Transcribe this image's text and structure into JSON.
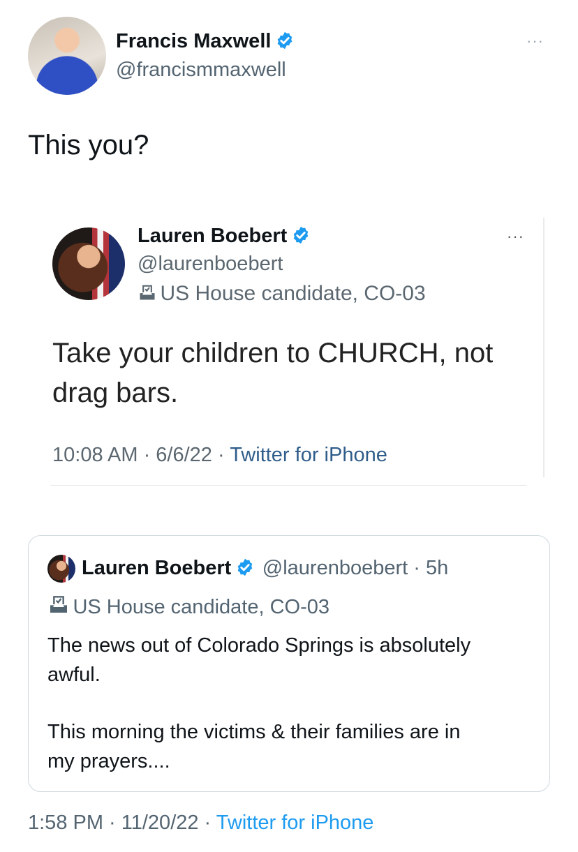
{
  "author": {
    "name": "Francis Maxwell",
    "handle": "@francismmaxwell",
    "more": "···"
  },
  "tweet": {
    "text": "This you?"
  },
  "screenshot": {
    "name": "Lauren Boebert",
    "handle": "@laurenboebert",
    "label": "US House candidate, CO-03",
    "more": "···",
    "text_line1": "Take your children to CHURCH, not",
    "text_line2": "drag bars.",
    "time": "10:08 AM · 6/6/22 · ",
    "source": "Twitter for iPhone"
  },
  "quote": {
    "name": "Lauren Boebert",
    "handle_time": "@laurenboebert · 5h",
    "label": "US House candidate, CO-03",
    "para1_line1": "The news out of Colorado Springs is absolutely",
    "para1_line2": "awful.",
    "para2_line1": "This morning the victims & their families are in",
    "para2_line2": "my prayers...."
  },
  "footer": {
    "time": "1:58 PM · 11/20/22 · ",
    "source": "Twitter for iPhone"
  },
  "colors": {
    "verified": "#1d9bf0",
    "link": "#1d9bf0"
  },
  "icons": [
    "verified-badge-icon",
    "ballot-box-icon",
    "more-dots-icon"
  ]
}
